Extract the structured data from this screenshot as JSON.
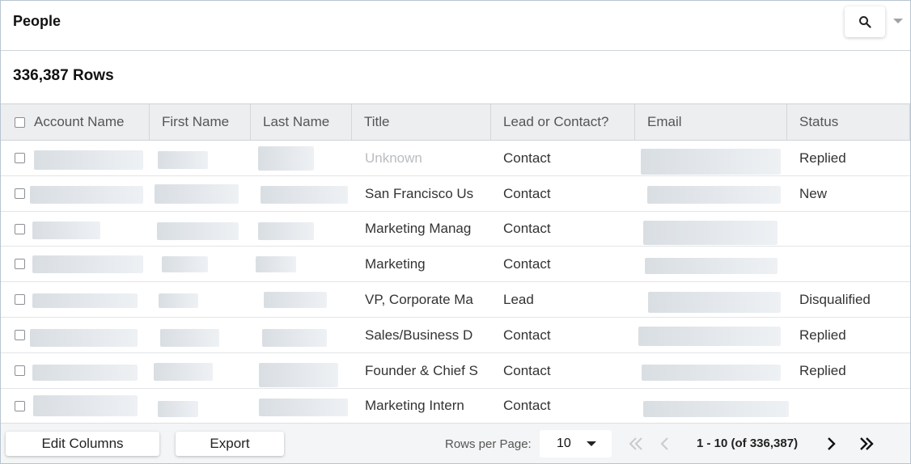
{
  "header": {
    "title": "People",
    "search_icon": "search-icon",
    "menu_icon": "caret-down-icon"
  },
  "row_count": "336,387 Rows",
  "table": {
    "columns": [
      "Account Name",
      "First Name",
      "Last Name",
      "Title",
      "Lead or Contact?",
      "Email",
      "Status"
    ],
    "rows": [
      {
        "title": "Unknown",
        "type": "Contact",
        "status": "Replied"
      },
      {
        "title": "San Francisco Us",
        "type": "Contact",
        "status": "New"
      },
      {
        "title": "Marketing Manag",
        "type": "Contact",
        "status": ""
      },
      {
        "title": "Marketing",
        "type": "Contact",
        "status": ""
      },
      {
        "title": "VP, Corporate Ma",
        "type": "Lead",
        "status": "Disqualified"
      },
      {
        "title": "Sales/Business D",
        "type": "Contact",
        "status": "Replied"
      },
      {
        "title": "Founder & Chief S",
        "type": "Contact",
        "status": "Replied"
      },
      {
        "title": "Marketing Intern",
        "type": "Contact",
        "status": ""
      }
    ]
  },
  "footer": {
    "edit_columns_label": "Edit Columns",
    "export_label": "Export",
    "rows_per_page_label": "Rows per Page:",
    "rows_per_page_value": "10",
    "range_text": "1 - 10 (of 336,387)"
  },
  "colors": {
    "header_bg": "#eceeef",
    "disabled_icon": "#c7cbcf",
    "muted_text": "#b9bdc1"
  }
}
